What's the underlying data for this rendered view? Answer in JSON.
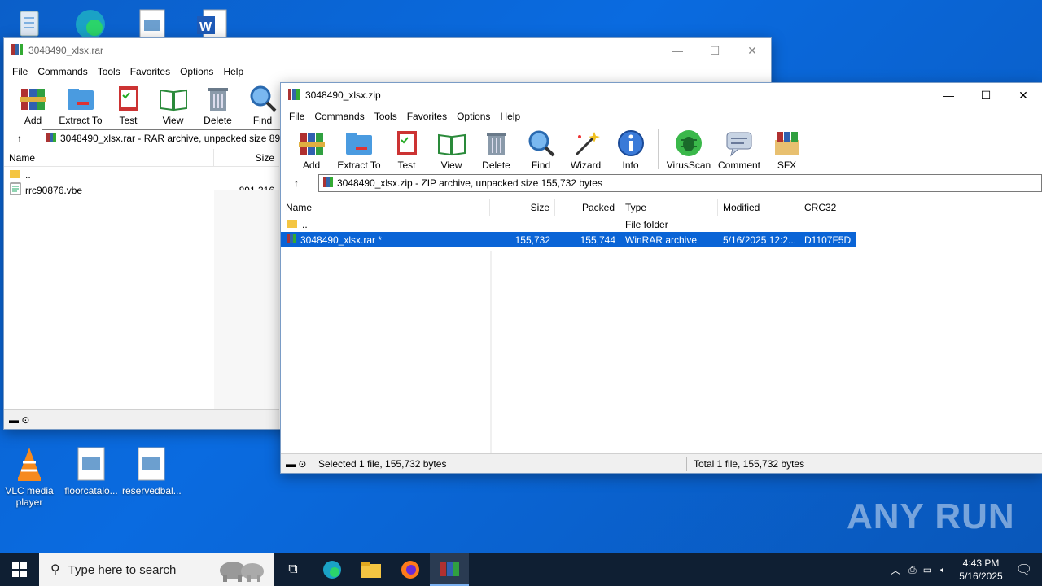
{
  "desktop": {
    "top_icons": [
      "recycle-bin",
      "edge",
      "image-file",
      "word-doc"
    ],
    "bottom_icons": [
      {
        "label": "VLC media player",
        "icon": "vlc-icon"
      },
      {
        "label": "floorcatalo...",
        "icon": "image-file-icon"
      },
      {
        "label": "reservedbal...",
        "icon": "image-file-icon"
      }
    ],
    "watermark": "ANY RUN"
  },
  "rar_window": {
    "title": "3048490_xlsx.rar",
    "menu": [
      "File",
      "Commands",
      "Tools",
      "Favorites",
      "Options",
      "Help"
    ],
    "tools": [
      "Add",
      "Extract To",
      "Test",
      "View",
      "Delete",
      "Find"
    ],
    "address": "3048490_xlsx.rar - RAR archive, unpacked size 891",
    "columns": [
      "Name",
      "Size"
    ],
    "rows": [
      {
        "name": "..",
        "size": ""
      },
      {
        "name": "rrc90876.vbe",
        "size": "891,316"
      }
    ]
  },
  "zip_window": {
    "title": "3048490_xlsx.zip",
    "menu": [
      "File",
      "Commands",
      "Tools",
      "Favorites",
      "Options",
      "Help"
    ],
    "tools": [
      "Add",
      "Extract To",
      "Test",
      "View",
      "Delete",
      "Find",
      "Wizard",
      "Info",
      "VirusScan",
      "Comment",
      "SFX"
    ],
    "address": "3048490_xlsx.zip - ZIP archive, unpacked size 155,732 bytes",
    "columns": [
      "Name",
      "Size",
      "Packed",
      "Type",
      "Modified",
      "CRC32"
    ],
    "rows": [
      {
        "name": "..",
        "size": "",
        "packed": "",
        "type": "File folder",
        "modified": "",
        "crc": ""
      },
      {
        "name": "3048490_xlsx.rar *",
        "size": "155,732",
        "packed": "155,744",
        "type": "WinRAR archive",
        "modified": "5/16/2025 12:2...",
        "crc": "D1107F5D"
      }
    ],
    "status_left": "Selected 1 file, 155,732 bytes",
    "status_right": "Total 1 file, 155,732 bytes"
  },
  "taskbar": {
    "search_placeholder": "Type here to search",
    "time": "4:43 PM",
    "date": "5/16/2025"
  },
  "colors": {
    "selection": "#0a64d6",
    "taskbar": "#0f1f33"
  }
}
